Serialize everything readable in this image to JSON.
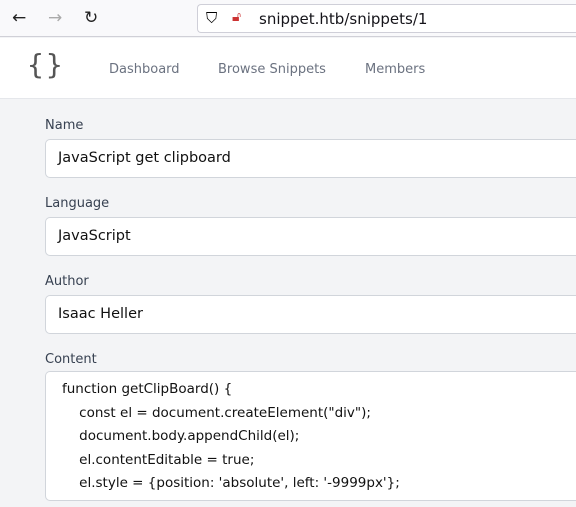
{
  "browser": {
    "url": "snippet.htb/snippets/1"
  },
  "nav": {
    "logo": "{}",
    "links": [
      "Dashboard",
      "Browse Snippets",
      "Members"
    ]
  },
  "form": {
    "name_label": "Name",
    "name_value": "JavaScript get clipboard",
    "language_label": "Language",
    "language_value": "JavaScript",
    "author_label": "Author",
    "author_value": "Isaac Heller",
    "content_label": "Content",
    "content_lines": [
      "function getClipBoard() {",
      "    const el = document.createElement(\"div\");",
      "    document.body.appendChild(el);",
      "    el.contentEditable = true;",
      "    el.style = {position: 'absolute', left: '-9999px'};"
    ]
  }
}
